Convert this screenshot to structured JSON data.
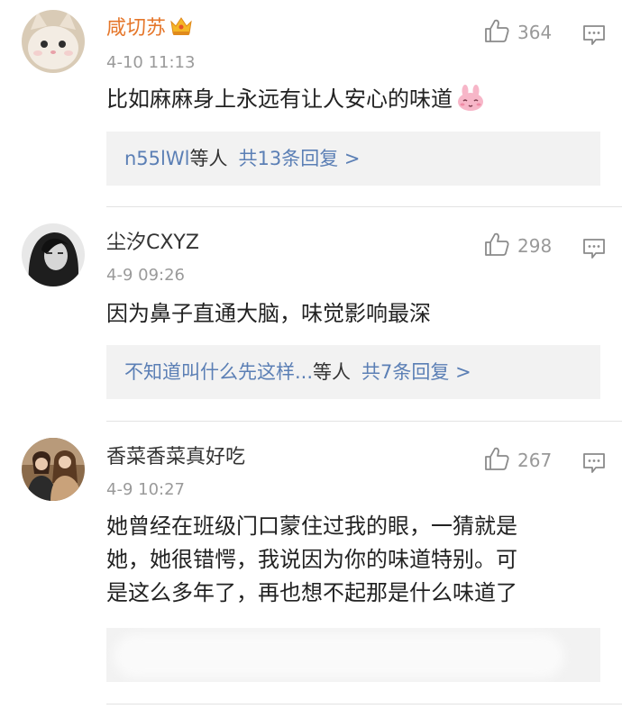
{
  "comments": [
    {
      "username": "咸切苏",
      "vip": true,
      "vip_badge_icon": "crown-vip-icon",
      "time": "4-10 11:13",
      "likes": "364",
      "text_lines": [
        "比如麻麻身上永远有让人安心的味道"
      ],
      "emoji_icon": "pink-bunny-emoji-icon",
      "replies": {
        "who": "n55lWl",
        "etc": "等人",
        "total": "共13条回复 >"
      }
    },
    {
      "username": "尘汐CXYZ",
      "vip": false,
      "time": "4-9 09:26",
      "likes": "298",
      "text_lines": [
        "因为鼻子直通大脑，味觉影响最深"
      ],
      "replies": {
        "who": "不知道叫什么先这样...",
        "etc": "等人",
        "total": "共7条回复 >"
      }
    },
    {
      "username": "香菜香菜真好吃",
      "vip": false,
      "time": "4-9 10:27",
      "likes": "267",
      "text_lines": [
        "她曾经在班级门口蒙住过我的眼，一猜就是",
        "她，她很错愕，我说因为你的味道特别。可",
        "是这么多年了，再也想不起那是什么味道了"
      ]
    }
  ],
  "colors": {
    "vip_name": "#e5762a",
    "link_blue": "#5b7fb5",
    "meta_gray": "#9a9a9a",
    "reply_bg": "#f2f2f2"
  },
  "icons": {
    "like": "thumbs-up-icon",
    "reply": "comment-bubble-icon"
  }
}
